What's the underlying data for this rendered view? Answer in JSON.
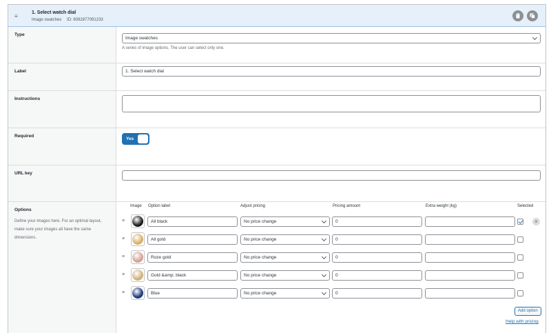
{
  "header": {
    "title": "1. Select watch dial",
    "type_label": "Image swatches",
    "id_text": "ID: 6092877091233"
  },
  "fields": {
    "type": {
      "label": "Type",
      "value": "Image swatches",
      "help": "A series of image options. The user can select only one."
    },
    "label": {
      "label": "Label",
      "value": "1. Select watch dial"
    },
    "instructions": {
      "label": "Instructions",
      "value": ""
    },
    "required": {
      "label": "Required",
      "value": "Yes"
    },
    "url_key": {
      "label": "URL key",
      "value": ""
    }
  },
  "options_section": {
    "label": "Options",
    "description": "Define your images here. For an optimal layout, make sure your images all have the same dimensions.",
    "columns": {
      "image": "Image",
      "option_label": "Option label",
      "adjust_pricing": "Adjust pricing",
      "pricing_amount": "Pricing amount",
      "extra_weight": "Extra weight (kg)",
      "selected": "Selected"
    },
    "rows": [
      {
        "label": "All black",
        "pricing": "No price change",
        "amount": "0",
        "weight": "",
        "selected": true,
        "dial_color": "#1a1a1a"
      },
      {
        "label": "All gold",
        "pricing": "No price change",
        "amount": "0",
        "weight": "",
        "selected": false,
        "dial_color": "#d8b06a"
      },
      {
        "label": "Roze gold",
        "pricing": "No price change",
        "amount": "0",
        "weight": "",
        "selected": false,
        "dial_color": "#d4a196"
      },
      {
        "label": "Gold &amp; black",
        "pricing": "No price change",
        "amount": "0",
        "weight": "",
        "selected": false,
        "dial_color": "#cfb27c"
      },
      {
        "label": "Blue",
        "pricing": "No price change",
        "amount": "0",
        "weight": "",
        "selected": false,
        "dial_color": "#1f3a7a"
      }
    ],
    "add_option_label": "Add option",
    "help_link": "Help with pricing"
  },
  "colors": {
    "accent": "#2271b1",
    "header_bg": "#e6f0fa"
  }
}
